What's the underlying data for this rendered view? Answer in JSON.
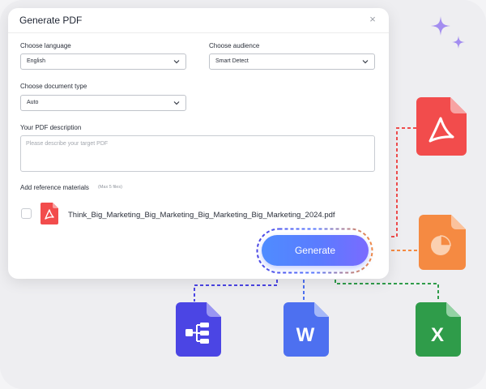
{
  "dialog": {
    "title": "Generate PDF",
    "close": "×",
    "language_label": "Choose language",
    "language_value": "English",
    "audience_label": "Choose audience",
    "audience_value": "Smart Detect",
    "doctype_label": "Choose document type",
    "doctype_value": "Auto",
    "description_label": "Your PDF description",
    "description_placeholder": "Please describe your target PDF",
    "reference_label": "Add reference materials",
    "reference_hint": "(Max 5 files)",
    "file_name": "Think_Big_Marketing_Big_Marketing_Big_Marketing_Big_Marketing_2024.pdf"
  },
  "generate_button": {
    "label": "Generate"
  },
  "outputs": {
    "word_glyph": "W",
    "excel_glyph": "X",
    "icons": [
      "pdf-icon",
      "presentation-icon",
      "mindmap-icon",
      "word-icon",
      "excel-icon"
    ]
  },
  "colors": {
    "pdf": "#f24c4c",
    "presentation": "#f58a42",
    "mindmap": "#4b45e4",
    "word": "#4d70f0",
    "excel": "#2f9c4a",
    "sparkle": "#a38df0",
    "button_start": "#4f8cff",
    "button_end": "#7a6bff"
  }
}
